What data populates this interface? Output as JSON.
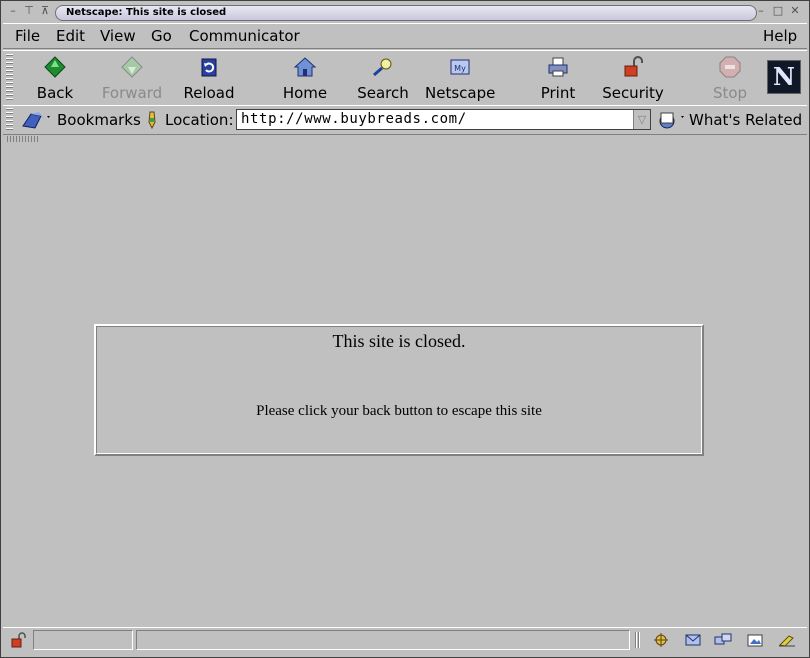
{
  "window": {
    "title": "Netscape: This site is closed"
  },
  "menu": [
    "File",
    "Edit",
    "View",
    "Go",
    "Communicator"
  ],
  "menu_help": "Help",
  "toolbar": {
    "back": "Back",
    "forward": "Forward",
    "reload": "Reload",
    "home": "Home",
    "search": "Search",
    "netscape": "Netscape",
    "print": "Print",
    "security": "Security",
    "stop": "Stop",
    "logo_letter": "N"
  },
  "location_bar": {
    "bookmarks": "Bookmarks",
    "location_label": "Location:",
    "url": "http://www.buybreads.com/",
    "whats_related": "What's Related"
  },
  "page": {
    "heading": "This site is closed.",
    "message": "Please click your back button to escape this site"
  },
  "status": {
    "text": ""
  },
  "colors": {
    "chrome": "#c0c0c0",
    "title_pill": "#d8d8e8"
  }
}
